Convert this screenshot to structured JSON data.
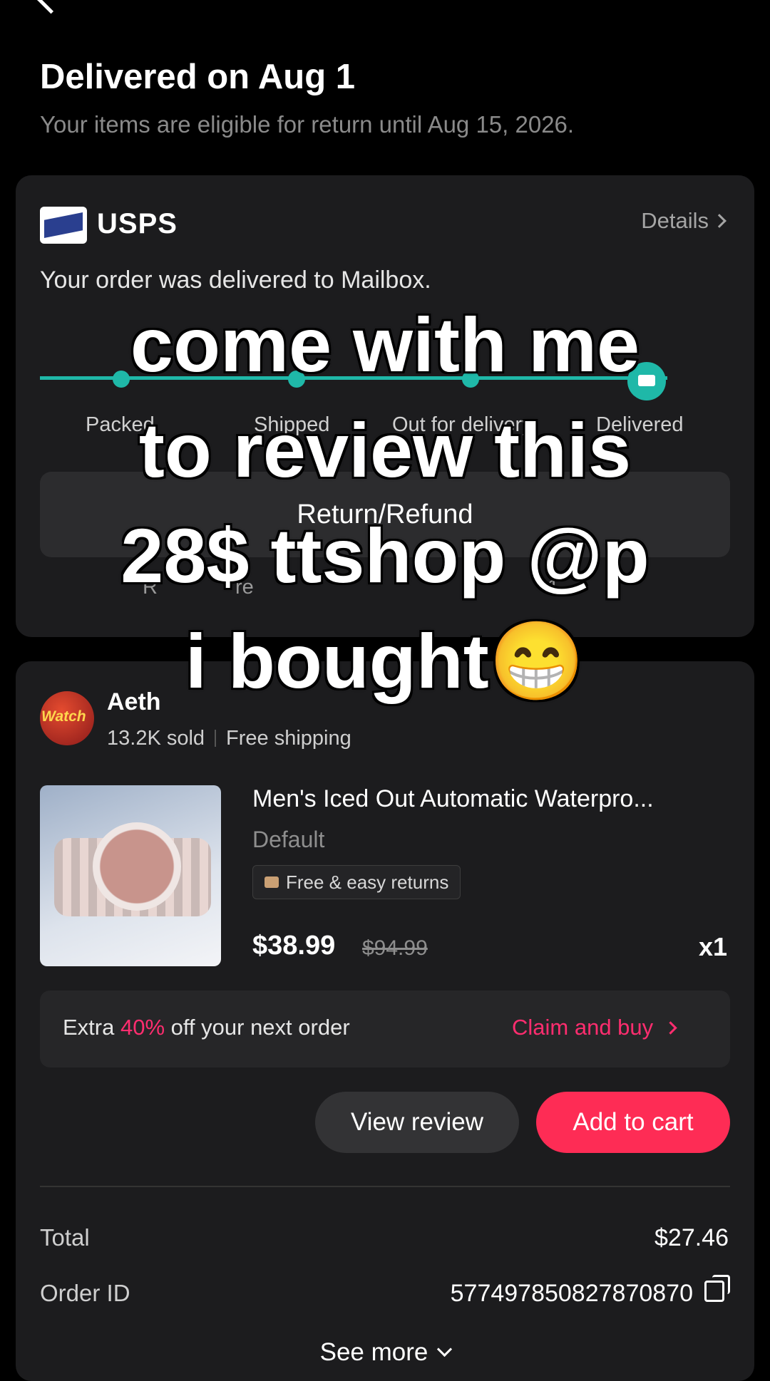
{
  "header": {
    "title": "Delivered on Aug 1",
    "subtitle": "Your items are eligible for return until Aug 15, 2026."
  },
  "shipping": {
    "carrier": "USPS",
    "details_label": "Details",
    "message": "Your order was delivered to Mailbox.",
    "steps": [
      "Packed",
      "Shipped",
      "Out for delivery",
      "Delivered"
    ],
    "return_button": "Return/Refund",
    "return_note_start": "R",
    "return_note_mid": "re",
    "return_note_end": "1"
  },
  "store": {
    "logo_text": "Watch",
    "name": "Aeth",
    "sold": "13.2K sold",
    "shipping": "Free shipping"
  },
  "product": {
    "title": "Men's Iced Out Automatic Waterpro...",
    "variant": "Default",
    "returns_tag": "Free & easy returns",
    "price": "$38.99",
    "original_price": "$94.99",
    "quantity": "x1"
  },
  "promo": {
    "prefix": "Extra ",
    "percent": "40%",
    "suffix": " off your next order",
    "cta": "Claim and buy"
  },
  "actions": {
    "view_review": "View review",
    "add_to_cart": "Add to cart"
  },
  "summary": {
    "total_label": "Total",
    "total_value": "$27.46",
    "order_id_label": "Order ID",
    "order_id_value": "577497850827870870",
    "see_more": "See more"
  },
  "caption": {
    "line1": "come with me",
    "line2": "to review this",
    "line3": "28$ ttshop @p",
    "line4": "i bought😁"
  },
  "colors": {
    "accent": "#fe2c55",
    "tracking": "#1fb8a8",
    "card": "#1c1c1e"
  }
}
